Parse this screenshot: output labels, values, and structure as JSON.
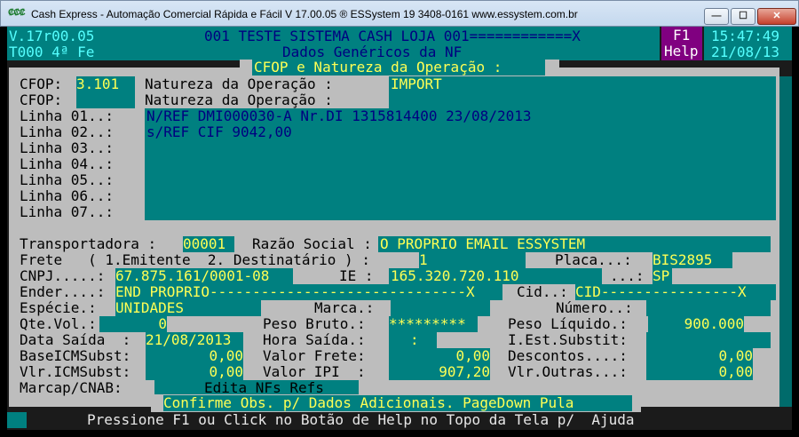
{
  "window": {
    "icon_text": "₡₡₡",
    "title": "Cash Express - Automação Comercial Rápida e Fácil V 17.00.05   ® ESSystem   19 3408-0161   www.essystem.com.br",
    "min_glyph": "—",
    "max_glyph": "☐",
    "close_glyph": "✕"
  },
  "header": {
    "version": "V.17r00.05",
    "terminal": "T000 4ª Fe",
    "company": "001 TESTE SISTEMA CASH LOJA 001============X",
    "subtitle": "Dados Genéricos da NF",
    "f1_label": "F1",
    "help_label": "Help",
    "time": "15:47:49",
    "date": "21/08/13"
  },
  "dialog": {
    "title": "CFOP e Natureza da Operação :",
    "cfop1_label": "CFOP:",
    "cfop1_value": "3.101",
    "cfop2_label": "CFOP:",
    "cfop2_value": "",
    "natureza1_label": "Natureza da Operação :",
    "natureza1_value": "IMPORT",
    "natureza2_label": "Natureza da Operação :",
    "natureza2_value": "",
    "linha_labels": [
      "Linha 01..:",
      "Linha 02..:",
      "Linha 03..:",
      "Linha 04..:",
      "Linha 05..:",
      "Linha 06..:",
      "Linha 07..:"
    ],
    "linha_values": [
      "N/REF DMI000030-A Nr.DI 1315814400 23/08/2013",
      "s/REF CIF 9042,00",
      "",
      "",
      "",
      "",
      ""
    ]
  },
  "nf": {
    "transportadora_label": "Transportadora :",
    "transportadora_value": "00001",
    "razao_label": "Razão Social :",
    "razao_value": "O PROPRIO EMAIL ESSYSTEM",
    "frete_label": "Frete   ( 1.Emitente  2. Destinatário ) :",
    "frete_value": "1",
    "placa_label": "Placa...:",
    "placa_value": "BIS2895",
    "cnpj_label": "CNPJ.....:",
    "cnpj_value": "67.875.161/0001-08",
    "ie_label": "IE :",
    "ie_value": "165.320.720.110",
    "uf_label": "...:",
    "uf_value": "SP",
    "ender_label": "Ender....:",
    "ender_value": "END PROPRIO------------------------------X",
    "cid_label": "Cid..:",
    "cid_value": "CID----------------X",
    "especie_label": "Espécie.:",
    "especie_value": "UNIDADES",
    "marca_label": "Marca.:",
    "marca_value": "",
    "numero_label": "Número..:",
    "numero_value": "",
    "qtevol_label": "Qte.Vol.:",
    "qtevol_value": "0",
    "pesobruto_label": "Peso Bruto.:",
    "pesobruto_value": "*********",
    "pesoliq_label": "Peso Líquido.:",
    "pesoliq_value": "900.000",
    "datasaida_label": "Data Saída  :",
    "datasaida_value": "21/08/2013",
    "horasaida_label": "Hora Saída.:",
    "horasaida_value": ":",
    "iest_label": "I.Est.Substit:",
    "iest_value": "",
    "baseicms_label": "BaseICMSubst:",
    "baseicms_value": "0,00",
    "valorfrete_label": "Valor Frete:",
    "valorfrete_value": "0,00",
    "descontos_label": "Descontos....:",
    "descontos_value": "0,00",
    "vlricms_label": "Vlr.ICMSubst:",
    "vlricms_value": "0,00",
    "valoripi_label": "Valor IPI  :",
    "valoripi_value": "907,20",
    "vlroutras_label": "Vlr.Outras...:",
    "vlroutras_value": "0,00",
    "marcap_label": "Marcap/CNAB:",
    "marcap_value": "",
    "edita_label": "Edita NFs Refs"
  },
  "footer": {
    "confirm": "Confirme Obs. p/ Dados Adicionais. PageDown Pula",
    "help_hint": "Pressione F1 ou Click no Botão de Help no Topo da Tela p/  Ajuda"
  }
}
